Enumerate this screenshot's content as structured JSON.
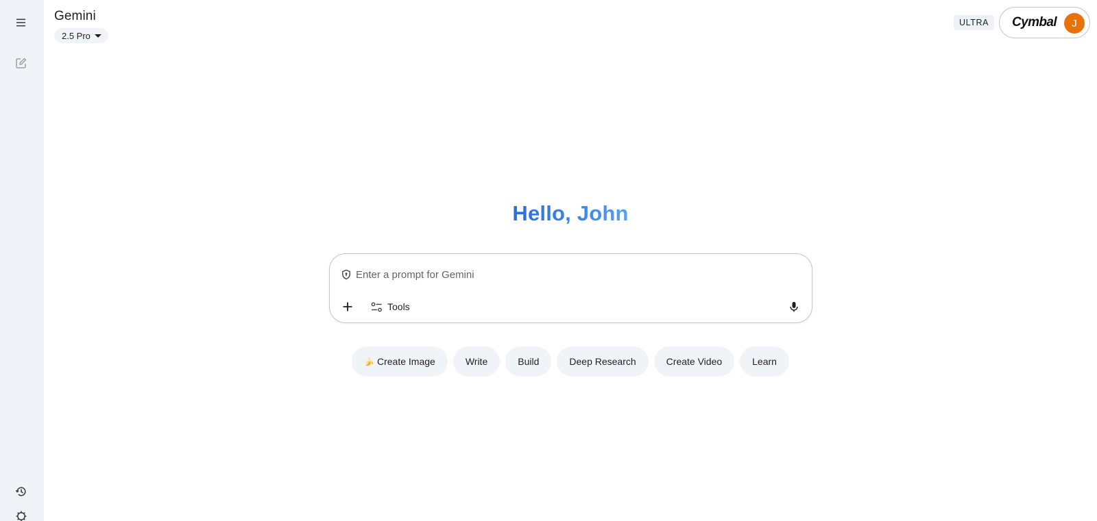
{
  "app": {
    "title": "Gemini",
    "model_label": "2.5 Pro"
  },
  "sidebar": {
    "top_buttons": [
      {
        "name": "menu-icon"
      },
      {
        "name": "new-chat-icon"
      }
    ],
    "bottom_buttons": [
      {
        "name": "history-icon"
      },
      {
        "name": "settings-icon"
      }
    ]
  },
  "header": {
    "tier_badge": "ULTRA",
    "org_name": "Cymbal",
    "avatar_initial": "J",
    "avatar_color": "#e8710a"
  },
  "greeting": {
    "text": "Hello, John"
  },
  "prompt": {
    "placeholder": "Enter a prompt for Gemini",
    "value": "",
    "tools_label": "Tools",
    "icons": [
      "shield-icon",
      "add-icon",
      "tools-icon",
      "mic-icon"
    ]
  },
  "suggestions": [
    {
      "label": "Create Image",
      "emoji": "🍌"
    },
    {
      "label": "Write"
    },
    {
      "label": "Build"
    },
    {
      "label": "Deep Research"
    },
    {
      "label": "Create Video"
    },
    {
      "label": "Learn"
    }
  ],
  "colors": {
    "accent_blue": "#3f86e8",
    "sidebar_bg": "#f0f4f9",
    "chip_bg": "#f0f4f9"
  }
}
